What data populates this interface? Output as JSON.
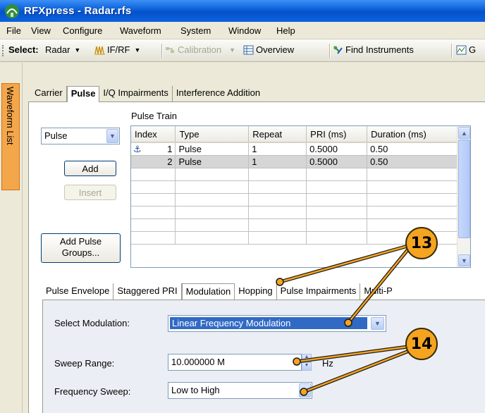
{
  "window": {
    "title": "RFXpress - Radar.rfs"
  },
  "menu": [
    "File",
    "View",
    "Configure",
    "Waveform",
    "System",
    "Window",
    "Help"
  ],
  "toolbar": {
    "select_label": "Select:",
    "radar": "Radar",
    "ifrf": "IF/RF",
    "calibration": "Calibration",
    "overview": "Overview",
    "find_instruments": "Find Instruments",
    "cut_label": "G"
  },
  "side_tab": "Waveform List",
  "tabs": [
    "Carrier",
    "Pulse",
    "I/Q Impairments",
    "Interference Addition"
  ],
  "active_tab": "Pulse",
  "left_panel": {
    "pulse_select": "Pulse",
    "add": "Add",
    "insert": "Insert",
    "add_groups_line1": "Add Pulse",
    "add_groups_line2": "Groups..."
  },
  "pulse_train": {
    "label": "Pulse Train",
    "columns": [
      "Index",
      "Type",
      "Repeat",
      "PRI (ms)",
      "Duration (ms)"
    ],
    "rows": [
      [
        "1",
        "Pulse",
        "1",
        "0.5000",
        "0.50"
      ],
      [
        "2",
        "Pulse",
        "1",
        "0.5000",
        "0.50"
      ]
    ],
    "empty_rows": 6
  },
  "subtabs": [
    "Pulse Envelope",
    "Staggered PRI",
    "Modulation",
    "Hopping",
    "Pulse Impairments",
    "Multi-P"
  ],
  "active_subtab": "Modulation",
  "modulation": {
    "select_label": "Select Modulation:",
    "select_value": "Linear Frequency Modulation",
    "sweep_range_label": "Sweep Range:",
    "sweep_range_value": "10.000000 M",
    "sweep_range_unit": "Hz",
    "frequency_sweep_label": "Frequency Sweep:",
    "frequency_sweep_value": "Low to High"
  },
  "callouts": [
    "13",
    "14"
  ],
  "colors": {
    "callout": "#f5a420",
    "selection": "#316ac5",
    "titlebar": "#0a5fd8",
    "side_tab": "#f4a64a"
  }
}
